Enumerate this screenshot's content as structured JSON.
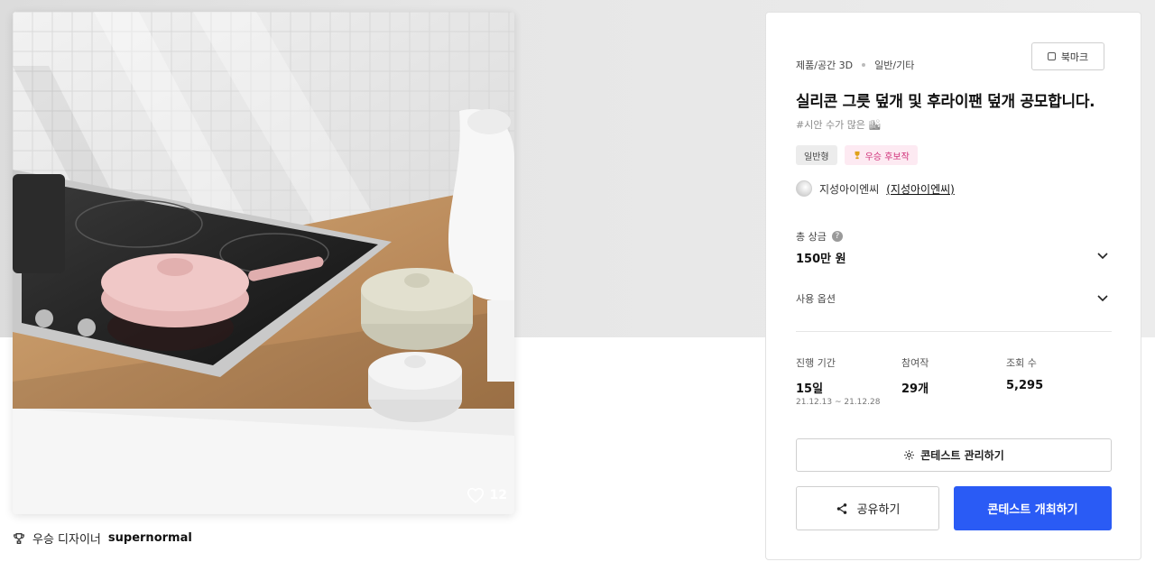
{
  "image": {
    "like_count": "12"
  },
  "winner": {
    "prefix": "우승 디자이너",
    "name": "supernormal"
  },
  "card": {
    "category": "제품/공간 3D",
    "subcategory": "일반/기타",
    "bookmark_label": "북마크",
    "title": "실리콘 그릇 덮개 및 후라이팬 덮개 공모합니다.",
    "tagline": "#시안 수가 많은 🏙",
    "chips": {
      "type": "일반형",
      "award": "우승 후보작"
    },
    "host": {
      "name": "지성아이엔씨",
      "link": "(지성아이엔씨)"
    },
    "prize": {
      "label": "총 상금",
      "help": "?",
      "value": "150만 원"
    },
    "options_label": "사용 옵션",
    "stats": {
      "period_label": "진행 기간",
      "period_value": "15일",
      "period_dates": "21.12.13 ~ 21.12.28",
      "entries_label": "참여작",
      "entries_value": "29개",
      "views_label": "조회 수",
      "views_value": "5,295"
    },
    "manage_label": "콘테스트 관리하기",
    "share_label": "공유하기",
    "host_label": "콘테스트 개최하기"
  },
  "colors": {
    "primary": "#2a5bf5",
    "award_pink": "#d0317a"
  },
  "icons": [
    "heart-icon",
    "trophy-icon",
    "bookmark-icon",
    "help-icon",
    "chevron-down-icon",
    "gear-icon",
    "share-icon"
  ]
}
